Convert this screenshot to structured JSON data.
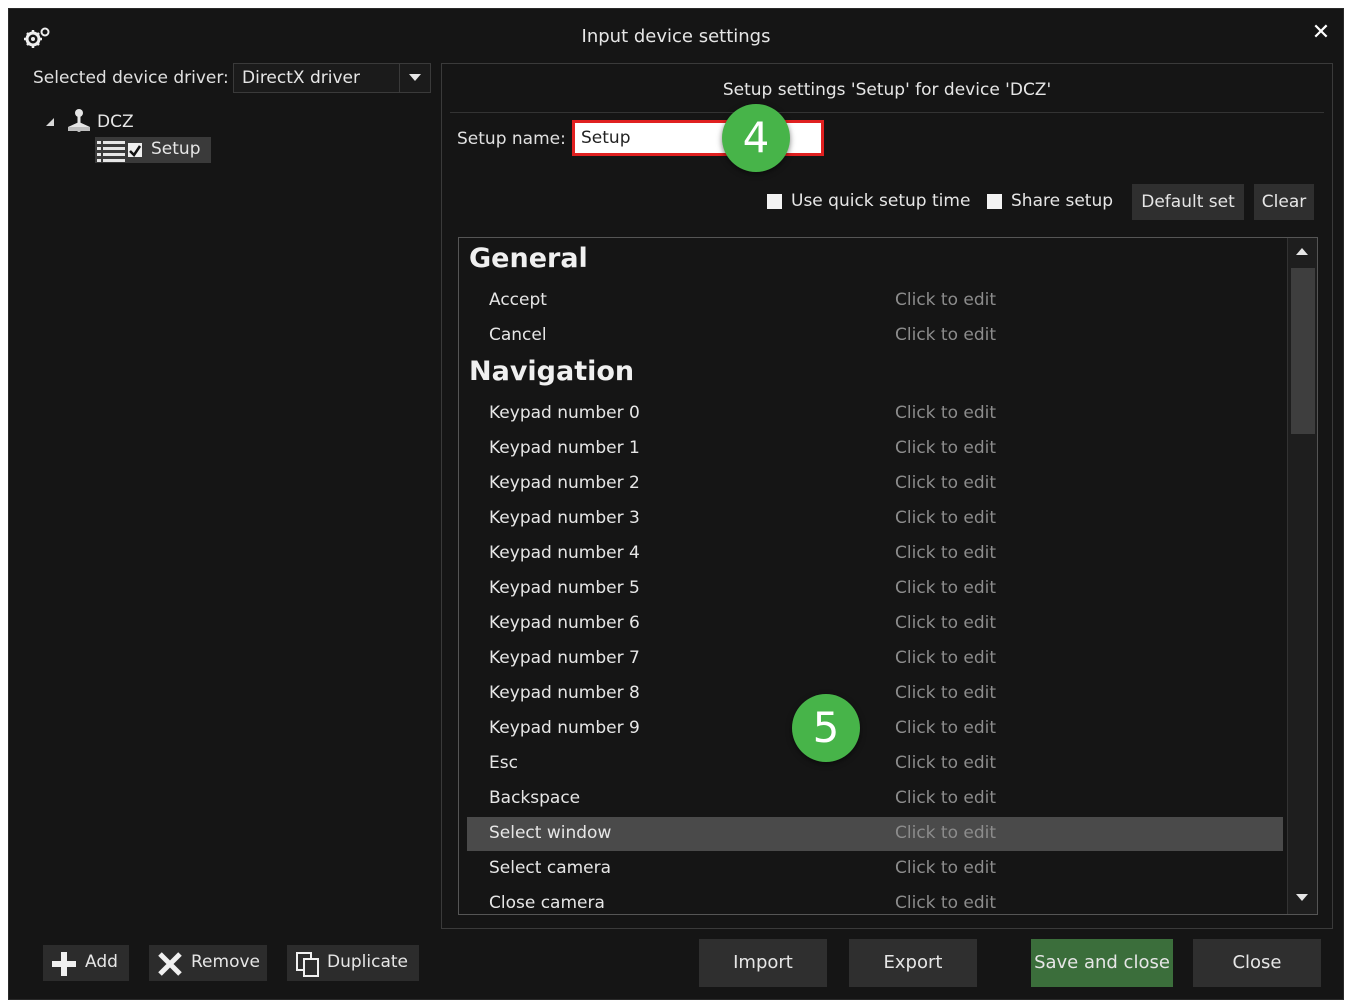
{
  "window": {
    "title": "Input device settings"
  },
  "driver": {
    "label": "Selected device driver:",
    "value": "DirectX driver"
  },
  "tree": {
    "device": "DCZ",
    "setup": "Setup"
  },
  "panel": {
    "header": "Setup settings 'Setup' for device 'DCZ'",
    "setup_name_label": "Setup name:",
    "setup_name_value": "Setup",
    "use_quick_setup_time": "Use quick setup time",
    "share_setup": "Share setup",
    "default_set": "Default set",
    "clear": "Clear"
  },
  "badges": {
    "step4": "4",
    "step5": "5"
  },
  "list": {
    "sections": [
      {
        "title": "General",
        "rows": [
          {
            "name": "Accept",
            "value": "Click to edit"
          },
          {
            "name": "Cancel",
            "value": "Click to edit"
          }
        ]
      },
      {
        "title": "Navigation",
        "rows": [
          {
            "name": "Keypad number 0",
            "value": "Click to edit"
          },
          {
            "name": "Keypad number 1",
            "value": "Click to edit"
          },
          {
            "name": "Keypad number 2",
            "value": "Click to edit"
          },
          {
            "name": "Keypad number 3",
            "value": "Click to edit"
          },
          {
            "name": "Keypad number 4",
            "value": "Click to edit"
          },
          {
            "name": "Keypad number 5",
            "value": "Click to edit"
          },
          {
            "name": "Keypad number 6",
            "value": "Click to edit"
          },
          {
            "name": "Keypad number 7",
            "value": "Click to edit"
          },
          {
            "name": "Keypad number 8",
            "value": "Click to edit"
          },
          {
            "name": "Keypad number 9",
            "value": "Click to edit"
          },
          {
            "name": "Esc",
            "value": "Click to edit"
          },
          {
            "name": "Backspace",
            "value": "Click to edit"
          },
          {
            "name": "Select window",
            "value": "Click to edit",
            "selected": true
          },
          {
            "name": "Select camera",
            "value": "Click to edit"
          },
          {
            "name": "Close camera",
            "value": "Click to edit"
          }
        ]
      }
    ]
  },
  "bottom": {
    "add": "Add",
    "remove": "Remove",
    "duplicate": "Duplicate"
  },
  "footer": {
    "import": "Import",
    "export": "Export",
    "save_and_close": "Save and close",
    "close": "Close"
  },
  "colors": {
    "background": "#151515",
    "accent_green": "#47b449",
    "highlight_red": "#e02020",
    "save_button": "#3b6e3b"
  }
}
